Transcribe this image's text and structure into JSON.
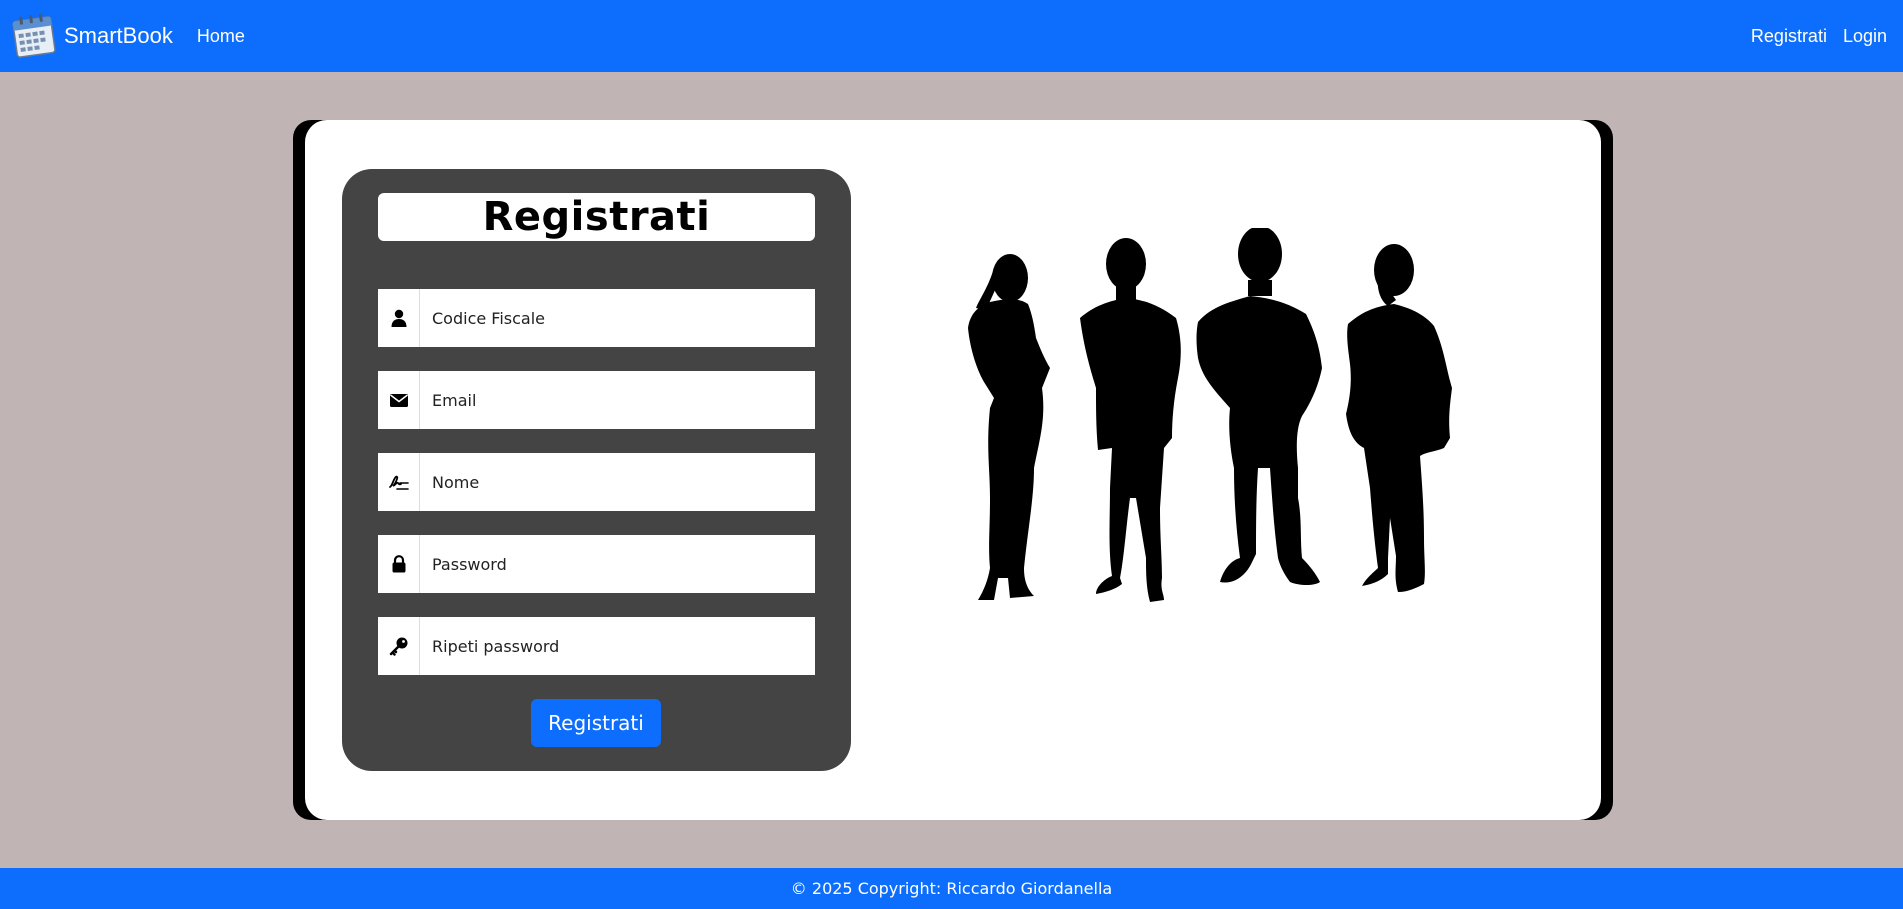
{
  "navbar": {
    "brand": "SmartBook",
    "brand_icon": "calendar-icon",
    "home": "Home",
    "register": "Registrati",
    "login": "Login",
    "color": "#0d6efd"
  },
  "form": {
    "title": "Registrati",
    "fields": [
      {
        "placeholder": "Codice Fiscale",
        "icon": "user-icon"
      },
      {
        "placeholder": "Email",
        "icon": "envelope-icon"
      },
      {
        "placeholder": "Nome",
        "icon": "signature-icon"
      },
      {
        "placeholder": "Password",
        "icon": "lock-icon"
      },
      {
        "placeholder": "Ripeti password",
        "icon": "key-icon"
      }
    ],
    "submit_label": "Registrati"
  },
  "illustration": {
    "icon": "people-silhouette-icon"
  },
  "footer": {
    "text": "© 2025 Copyright: Riccardo Giordanella"
  }
}
